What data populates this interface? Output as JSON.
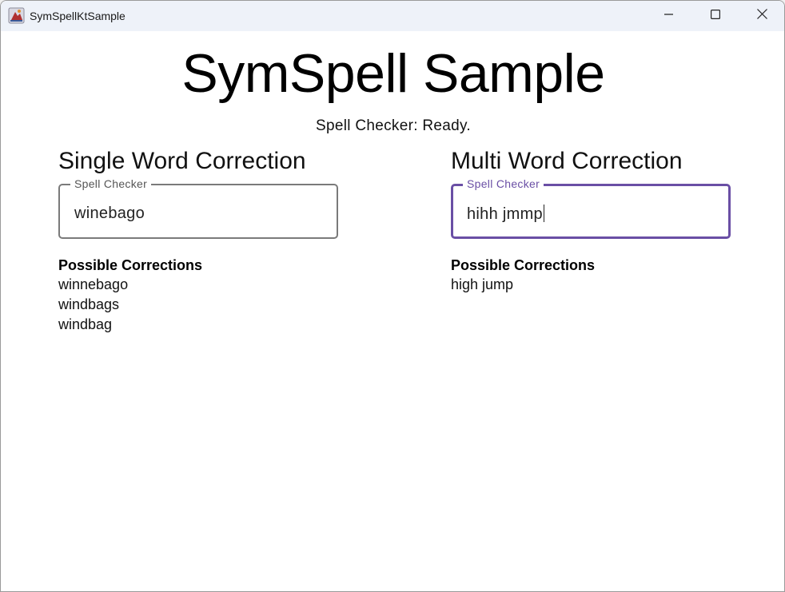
{
  "window": {
    "title": "SymSpellKtSample",
    "app_icon": "java-app-icon",
    "controls": {
      "minimize_icon": "minimize-icon",
      "maximize_icon": "maximize-icon",
      "close_icon": "close-icon"
    }
  },
  "main": {
    "title": "SymSpell Sample",
    "status": "Spell Checker: Ready."
  },
  "single": {
    "section_title": "Single Word Correction",
    "field_label": "Spell Checker",
    "field_value": "winebago",
    "corrections_heading": "Possible Corrections",
    "corrections": [
      "winnebago",
      "windbags",
      "windbag"
    ]
  },
  "multi": {
    "section_title": "Multi Word Correction",
    "field_label": "Spell Checker",
    "field_value": "hihh jmmp",
    "corrections_heading": "Possible Corrections",
    "corrections": [
      "high jump"
    ]
  },
  "colors": {
    "accent": "#6a4fa5",
    "titlebar": "#eef2f9"
  }
}
